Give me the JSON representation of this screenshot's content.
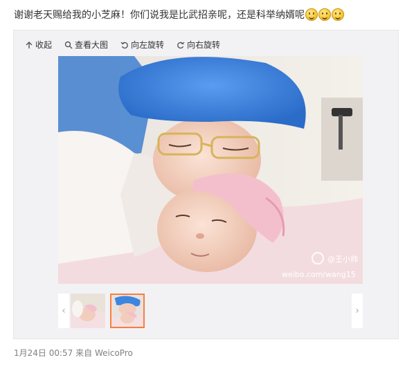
{
  "post": {
    "text": "谢谢老天赐给我的小芝麻！你们说我是比武招亲呢，还是科举纳婿呢",
    "emoticons": [
      "smile-emoticon",
      "smile-emoticon",
      "smile-emoticon"
    ]
  },
  "toolbar": {
    "collapse_label": "收起",
    "view_large_label": "查看大图",
    "rotate_left_label": "向左旋转",
    "rotate_right_label": "向右旋转"
  },
  "photo": {
    "watermark_handle": "@王小帅",
    "watermark_url": "weibo.com/wang15"
  },
  "thumbnails": {
    "count": 2,
    "selected_index": 1
  },
  "footer": {
    "timestamp": "1月24日 00:57",
    "from_label": "来自",
    "source": "WeicoPro"
  },
  "colors": {
    "selected_border": "#fa7d3c",
    "surgical_cap": "#3d86e0",
    "baby_hat": "#f4bfcc"
  }
}
